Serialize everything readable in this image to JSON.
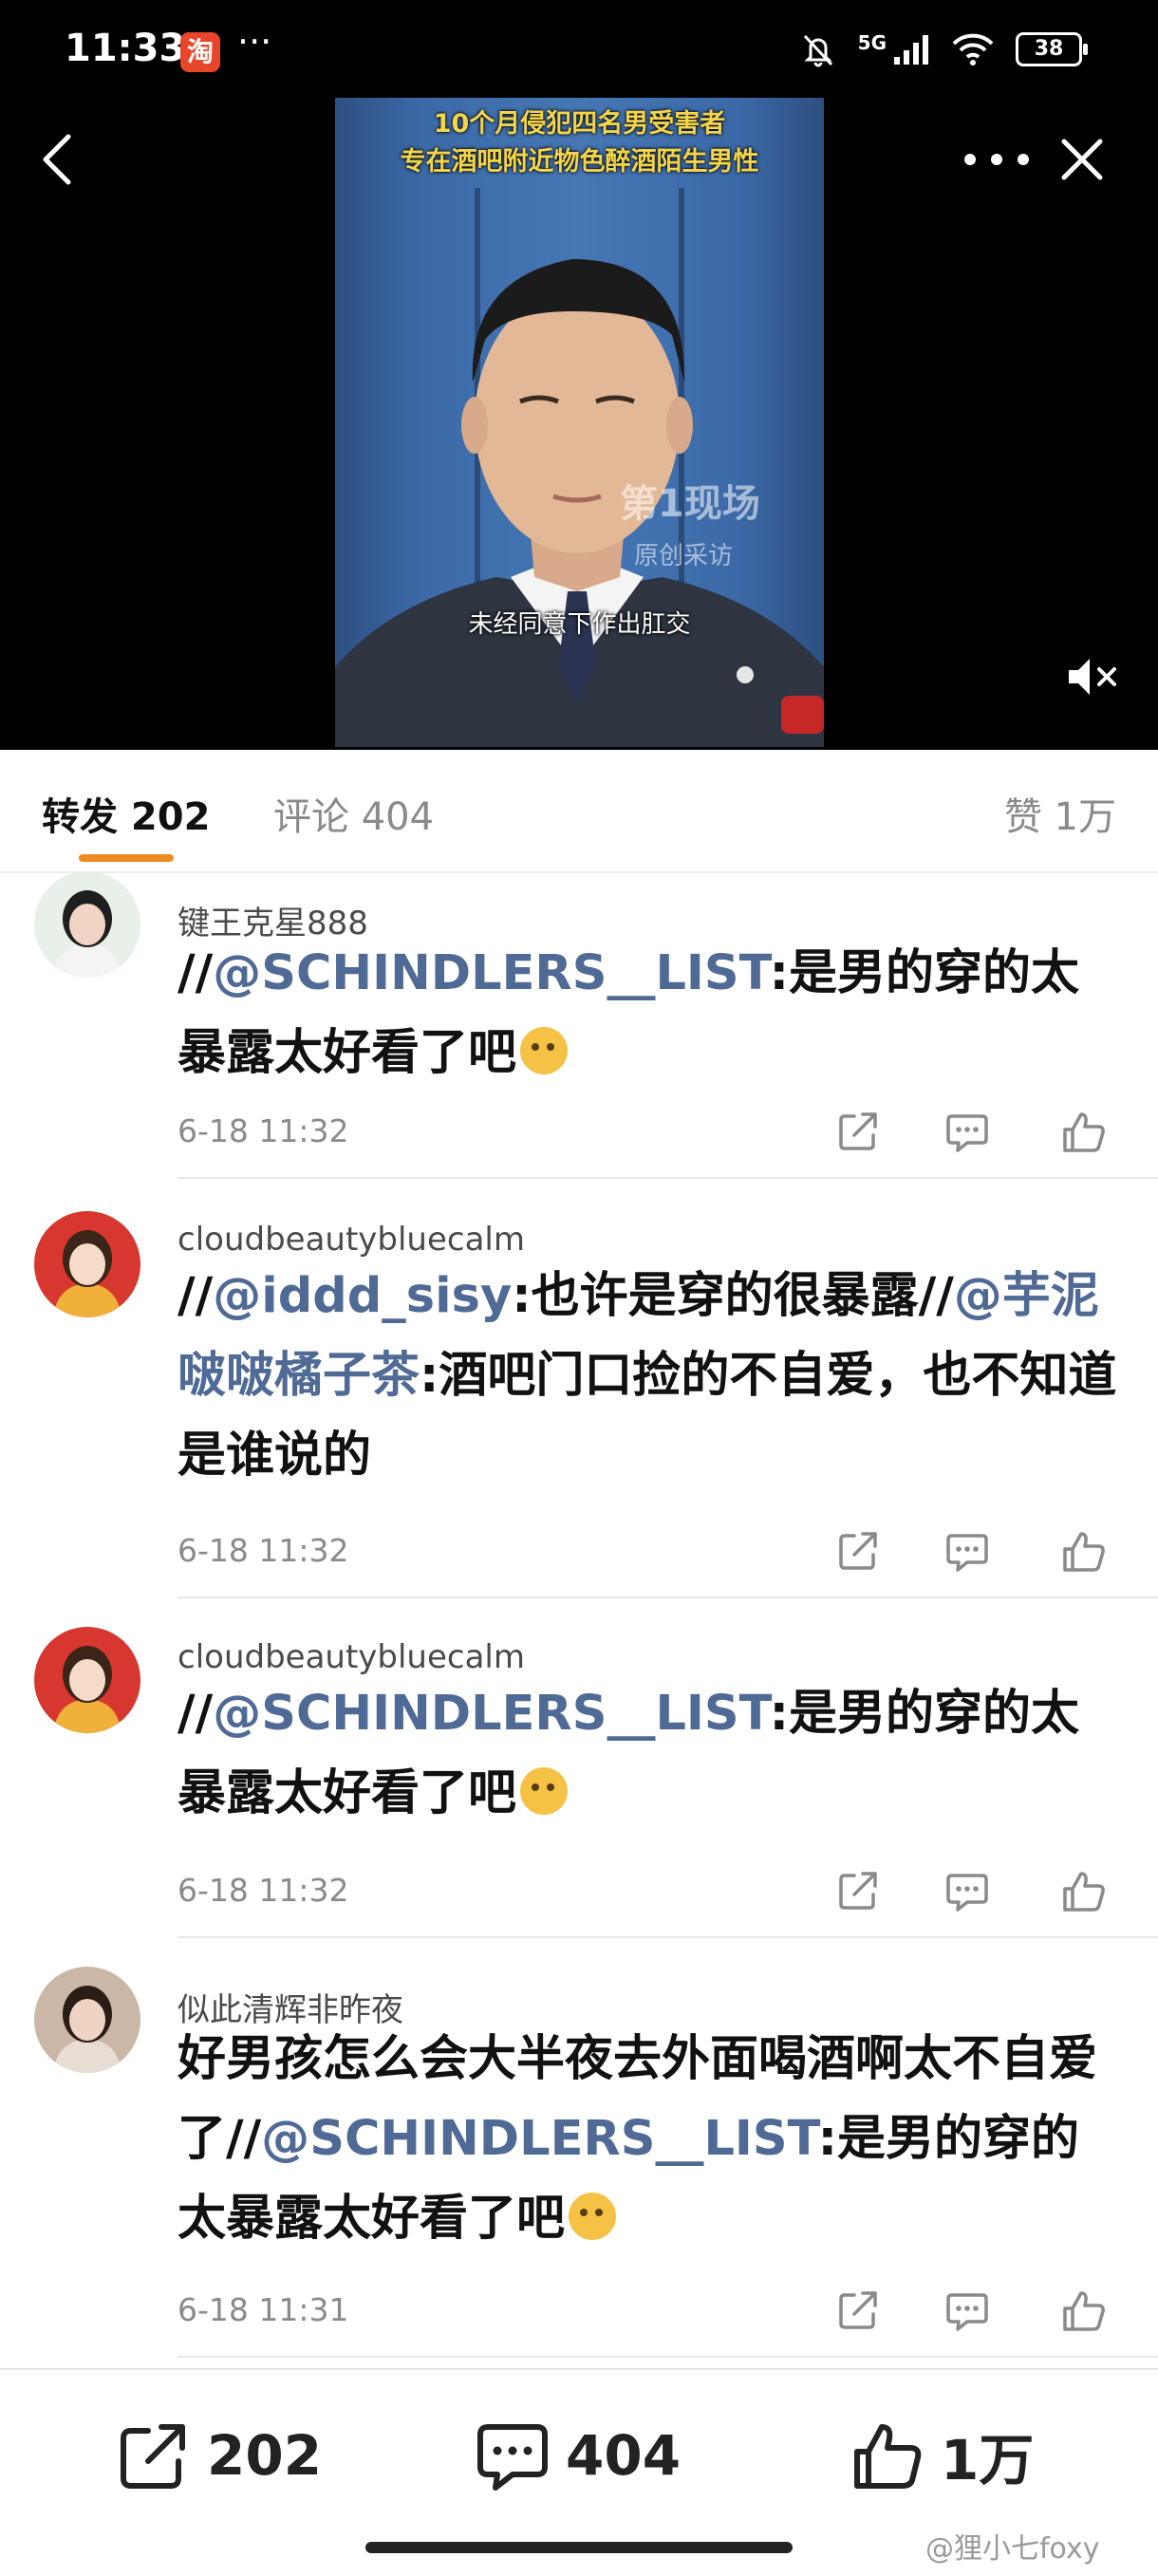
{
  "status": {
    "time": "11:33",
    "app_badge": "淘",
    "dots": "···",
    "network": "5G",
    "battery": "38"
  },
  "nav": {
    "back_icon": "chevron-left-icon",
    "more_icon": "more-dots-icon",
    "close_icon": "close-icon"
  },
  "video": {
    "banner_line1": "10个月侵犯四名男受害者",
    "banner_line2": "专在酒吧附近物色醉酒陌生男性",
    "watermark_main": "第1现场",
    "watermark_sub": "原创采访",
    "subtitle": "未经同意下作出肛交",
    "mute_icon": "mute-icon"
  },
  "tabs": {
    "repost": "转发 202",
    "comment": "评论 404",
    "like": "赞 1万"
  },
  "items": [
    {
      "user": "键王克星888",
      "segments": [
        {
          "t": "//",
          "m": false
        },
        {
          "t": "@SCHINDLERS__LIST",
          "m": true
        },
        {
          "t": ":是男的穿的太暴露太好看了吧",
          "m": false
        }
      ],
      "emoji": true,
      "time": "6-18 11:32"
    },
    {
      "user": "cloudbeautybluecalm",
      "segments": [
        {
          "t": "//",
          "m": false
        },
        {
          "t": "@iddd_sisy",
          "m": true
        },
        {
          "t": ":也许是穿的很暴露//",
          "m": false
        },
        {
          "t": "@芋泥啵啵橘子茶",
          "m": true
        },
        {
          "t": ":酒吧门口捡的不自爱，也不知道是谁说的",
          "m": false
        }
      ],
      "emoji": false,
      "time": "6-18 11:32"
    },
    {
      "user": "cloudbeautybluecalm",
      "segments": [
        {
          "t": "//",
          "m": false
        },
        {
          "t": "@SCHINDLERS__LIST",
          "m": true
        },
        {
          "t": ":是男的穿的太暴露太好看了吧",
          "m": false
        }
      ],
      "emoji": true,
      "time": "6-18 11:32"
    },
    {
      "user": "似此清辉非昨夜",
      "segments": [
        {
          "t": "好男孩怎么会大半夜去外面喝酒啊太不自爱了//",
          "m": false
        },
        {
          "t": "@SCHINDLERS__LIST",
          "m": true
        },
        {
          "t": ":是男的穿的太暴露太好看了吧",
          "m": false
        }
      ],
      "emoji": true,
      "time": "6-18 11:31"
    }
  ],
  "bottom": {
    "repost_count": "202",
    "comment_count": "404",
    "like_count": "1万"
  },
  "credit": "@狸小七foxy",
  "colors": {
    "accent": "#f28a22",
    "mention": "#506a96",
    "emoji": "#f5c246"
  }
}
